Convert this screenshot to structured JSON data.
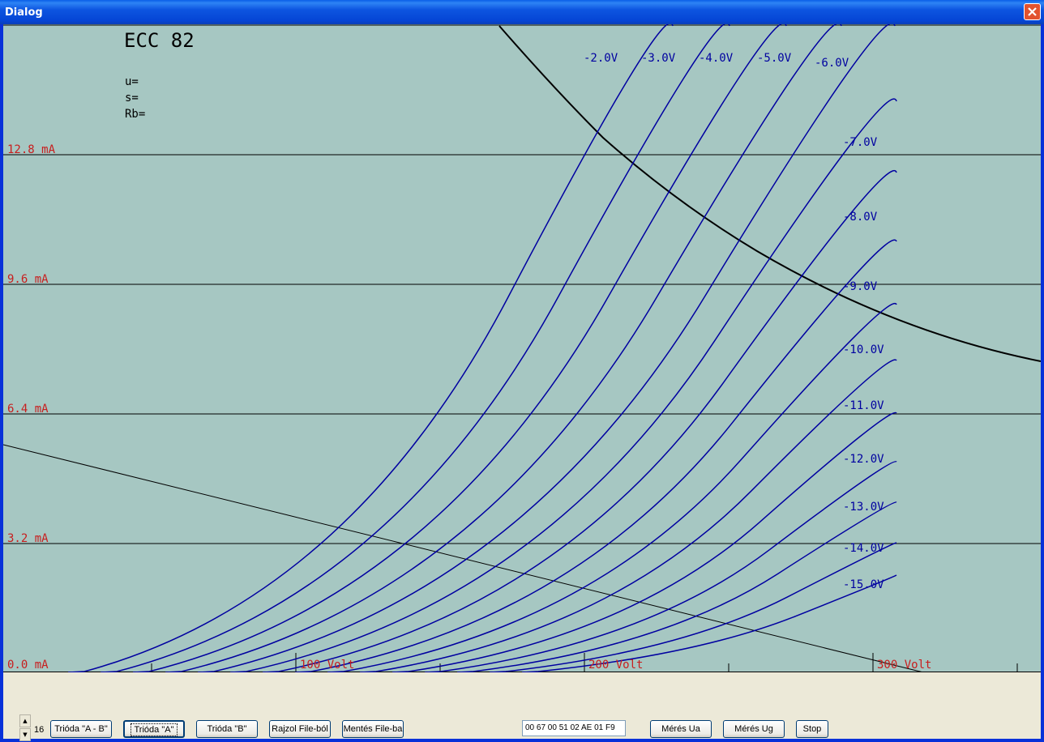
{
  "window": {
    "title": "Dialog"
  },
  "graph": {
    "tube": "ECC 82",
    "params": [
      "u=",
      "s=",
      "Rb="
    ],
    "current_labels": [
      "12.8 mA",
      "9.6 mA",
      "6.4 mA",
      "3.2 mA",
      "0.0 mA"
    ],
    "voltage_labels": [
      "100 Volt",
      "200 Volt",
      "300 Volt"
    ],
    "grid_labels": [
      "-2.0V",
      "-3.0V",
      "-4.0V",
      "-5.0V",
      "-6.0V",
      "-7.0V",
      "-8.0V",
      "-9.0V",
      "-10.0V",
      "-11.0V",
      "-12.0V",
      "-13.0V",
      "-14.0V",
      "-15.0V"
    ],
    "colors": {
      "background": "#A6C7C2",
      "curves": "#0000A0",
      "labels": "#C81E1E",
      "text": "#000000"
    }
  },
  "controls": {
    "spin_value": "16",
    "buttons": {
      "trioda_ab": "Trióda \"A - B\"",
      "trioda_a": "Trióda \"A\"",
      "trioda_b": "Trióda \"B\"",
      "rajzol": "Rajzol File-ból",
      "mentes": "Mentés File-ba",
      "meres_ua": "Mérés Ua",
      "meres_ug": "Mérés Ug",
      "stop": "Stop"
    },
    "hex_value": "00 67 00 51 02 AE 01 F9"
  }
}
